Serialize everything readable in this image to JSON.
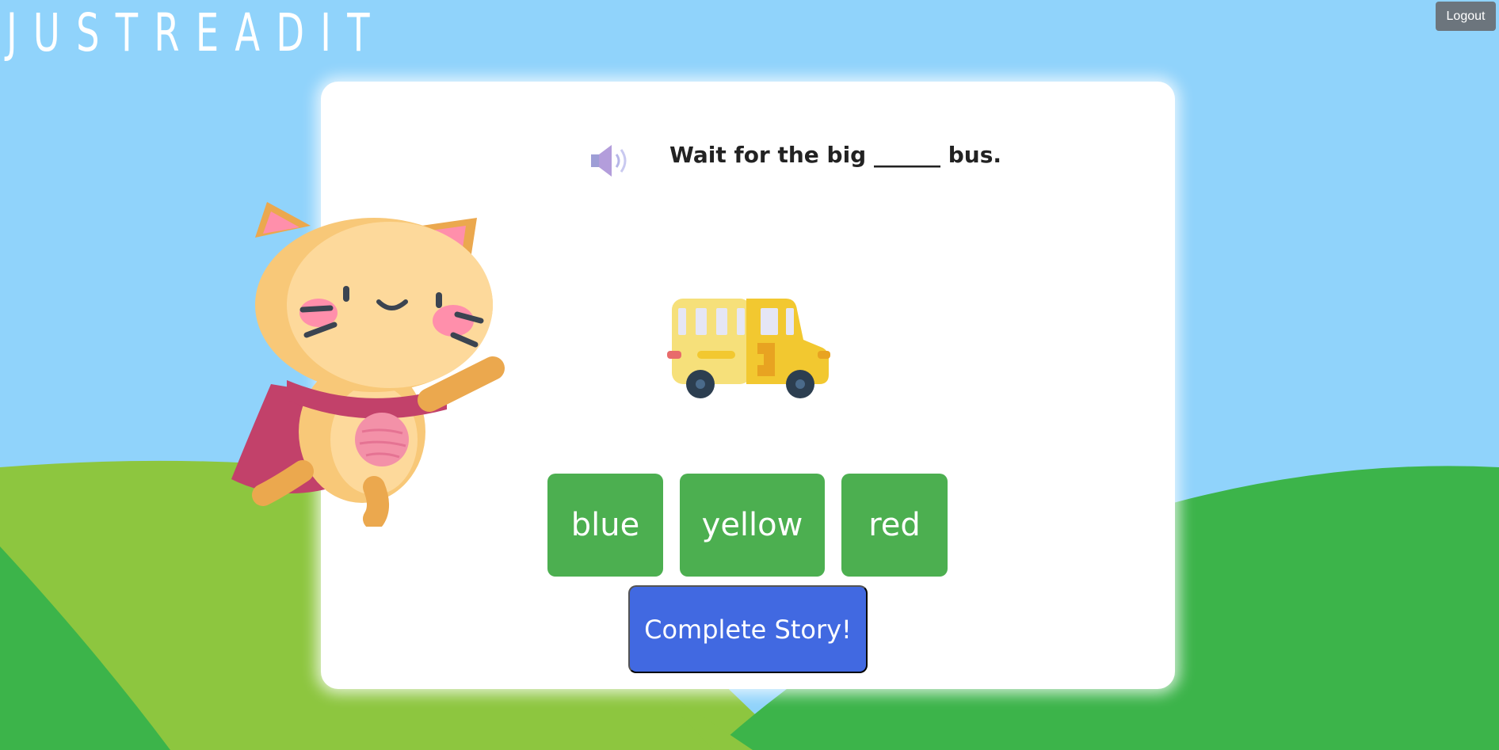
{
  "app": {
    "logo_text": "JUSTREADIT",
    "logout_label": "Logout"
  },
  "story": {
    "sentence": "Wait for the big ______ bus.",
    "speaker_icon": "speaker-icon",
    "picture": "school-bus-illustration",
    "choices": [
      "blue",
      "yellow",
      "red"
    ],
    "complete_label": "Complete Story!"
  },
  "colors": {
    "sky": "#90d3fb",
    "choice_button": "#4caf50",
    "complete_button": "#4169e1",
    "logout_button": "#6c757d"
  }
}
